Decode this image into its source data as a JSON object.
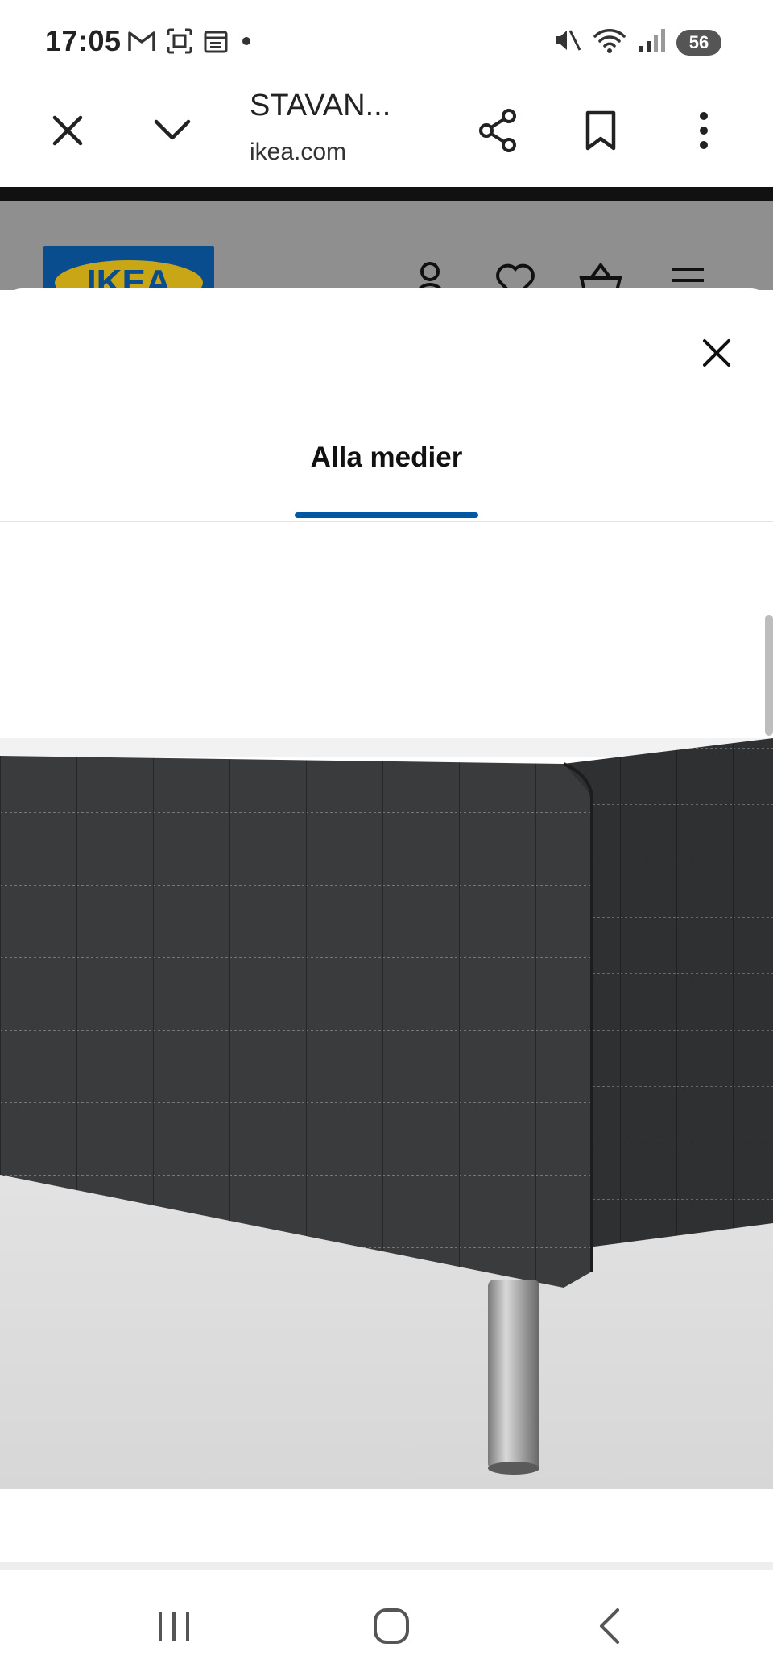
{
  "status_bar": {
    "time": "17:05",
    "left_icons": [
      "gmail-icon",
      "screenshot-icon",
      "calendar-icon",
      "dot-icon"
    ],
    "right_icons": [
      "mute-icon",
      "wifi-icon",
      "signal-icon"
    ],
    "battery": "56"
  },
  "browser": {
    "page_title": "STAVAN...",
    "url": "ikea.com",
    "buttons": [
      "close-icon",
      "chevron-down-icon",
      "share-icon",
      "bookmark-icon",
      "more-vert-icon"
    ]
  },
  "page_behind": {
    "logo_text": "IKEA",
    "header_icons": [
      "person-icon",
      "heart-icon",
      "basket-icon",
      "menu-icon"
    ]
  },
  "modal": {
    "tab_label": "Alla medier",
    "accent": "#0058a3",
    "image_subject": "bed-frame-photo"
  },
  "nav": {
    "buttons": [
      "recents-icon",
      "home-icon",
      "back-icon"
    ]
  }
}
